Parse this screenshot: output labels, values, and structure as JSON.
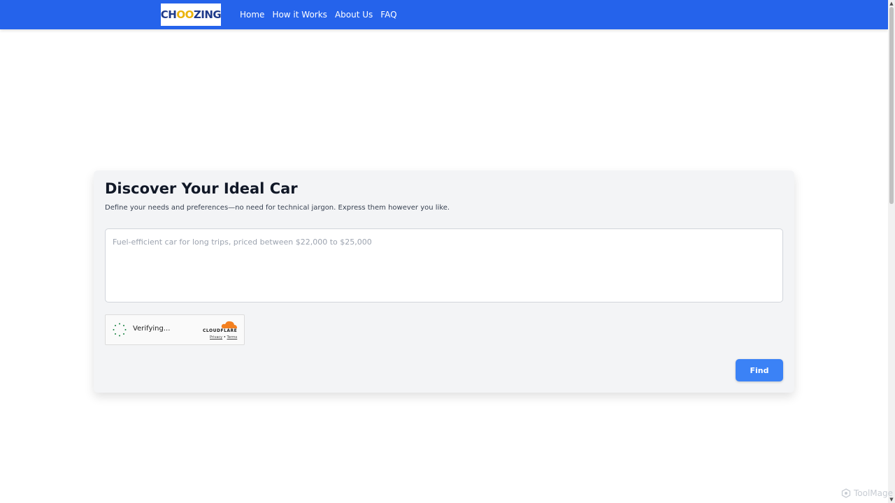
{
  "header": {
    "logo_text_part1": "CH",
    "logo_text_part2": "OO",
    "logo_text_part3": "ZING",
    "nav": [
      {
        "label": "Home"
      },
      {
        "label": "How it Works"
      },
      {
        "label": "About Us"
      },
      {
        "label": "FAQ"
      }
    ]
  },
  "main": {
    "title": "Discover Your Ideal Car",
    "subtitle": "Define your needs and preferences—no need for technical jargon. Express them however you like.",
    "query_value": "",
    "query_placeholder": "Fuel-efficient car for long trips, priced between $22,000 to $25,000",
    "captcha": {
      "status": "Verifying...",
      "provider": "CLOUDFLARE",
      "privacy_label": "Privacy",
      "separator": "•",
      "terms_label": "Terms"
    },
    "find_label": "Find"
  },
  "watermark": "ToolMage",
  "colors": {
    "header_bg": "#2563eb",
    "button_bg": "#3b82f6",
    "card_bg": "#f3f4f6",
    "cloudflare_orange": "#f38020"
  },
  "icons": {
    "spinner": "spinner-icon",
    "cloudflare": "cloudflare-cloud-icon",
    "watermark": "toolmage-icon"
  }
}
